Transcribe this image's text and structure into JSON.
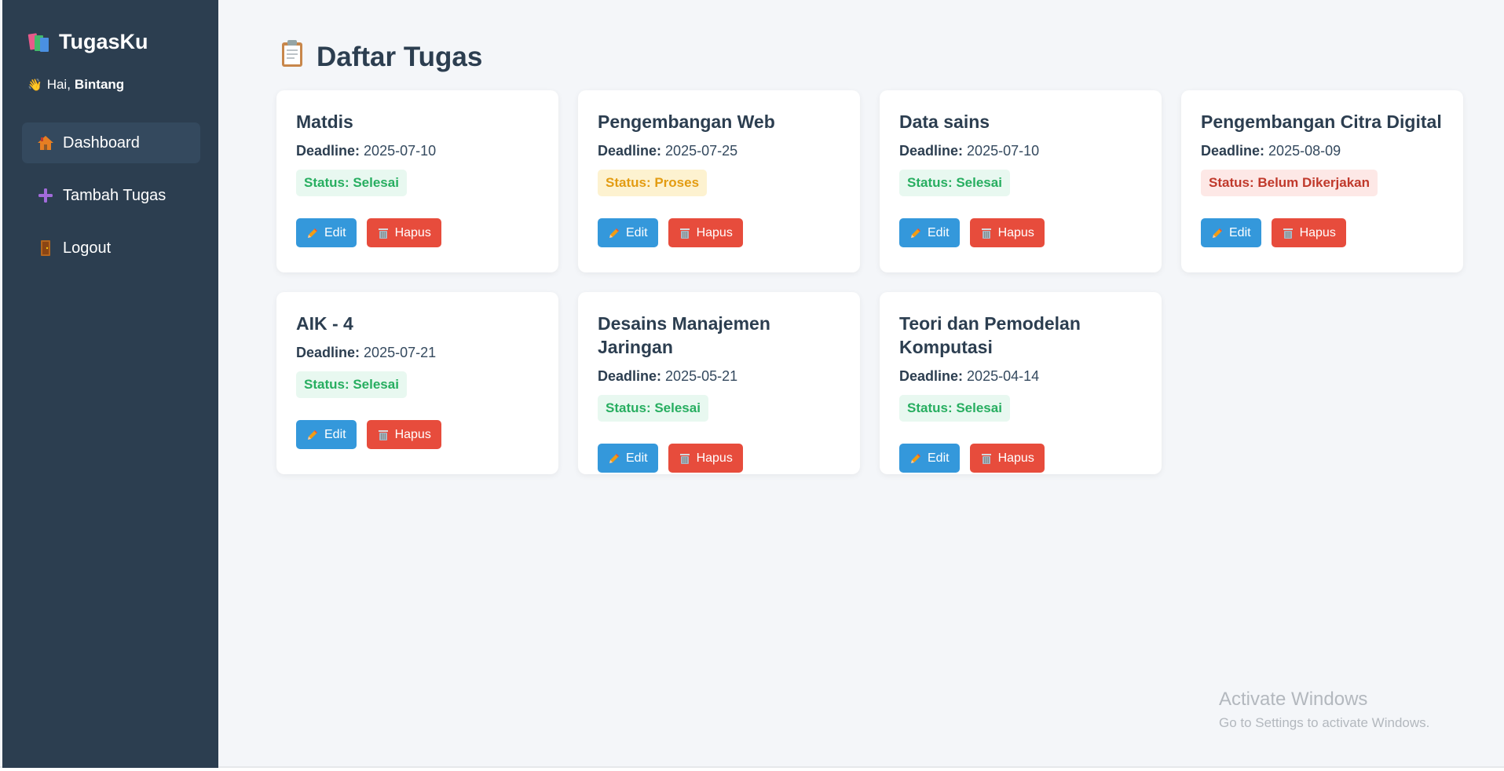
{
  "sidebar": {
    "brand": "TugasKu",
    "brand_icon": "books-icon",
    "greeting_prefix": "Hai,",
    "user_name": "Bintang",
    "greeting_icon": "waving-hand-icon",
    "items": [
      {
        "label": "Dashboard",
        "icon": "house-icon",
        "active": true
      },
      {
        "label": "Tambah Tugas",
        "icon": "plus-icon",
        "active": false
      },
      {
        "label": "Logout",
        "icon": "door-icon",
        "active": false
      }
    ]
  },
  "main": {
    "title": "Daftar Tugas",
    "title_icon": "clipboard-icon",
    "deadline_label": "Deadline:",
    "edit_label": "Edit",
    "delete_label": "Hapus",
    "tasks": [
      {
        "title": "Matdis",
        "deadline": "2025-07-10",
        "status": "Status: Selesai",
        "status_type": "done"
      },
      {
        "title": "Pengembangan Web",
        "deadline": "2025-07-25",
        "status": "Status: Proses",
        "status_type": "progress"
      },
      {
        "title": "Data sains",
        "deadline": "2025-07-10",
        "status": "Status: Selesai",
        "status_type": "done"
      },
      {
        "title": "Pengembangan Citra Digital",
        "deadline": "2025-08-09",
        "status": "Status: Belum Dikerjakan",
        "status_type": "todo"
      },
      {
        "title": "AIK - 4",
        "deadline": "2025-07-21",
        "status": "Status: Selesai",
        "status_type": "done"
      },
      {
        "title": "Desains Manajemen Jaringan",
        "deadline": "2025-05-21",
        "status": "Status: Selesai",
        "status_type": "done"
      },
      {
        "title": "Teori dan Pemodelan Komputasi",
        "deadline": "2025-04-14",
        "status": "Status: Selesai",
        "status_type": "done"
      }
    ]
  },
  "watermark": {
    "line1": "Activate Windows",
    "line2": "Go to Settings to activate Windows."
  },
  "colors": {
    "sidebar_bg": "#2c3e50",
    "edit": "#3498db",
    "delete": "#e74c3c",
    "done": "#27ae60",
    "progress": "#e39c12",
    "todo": "#c0392b"
  }
}
